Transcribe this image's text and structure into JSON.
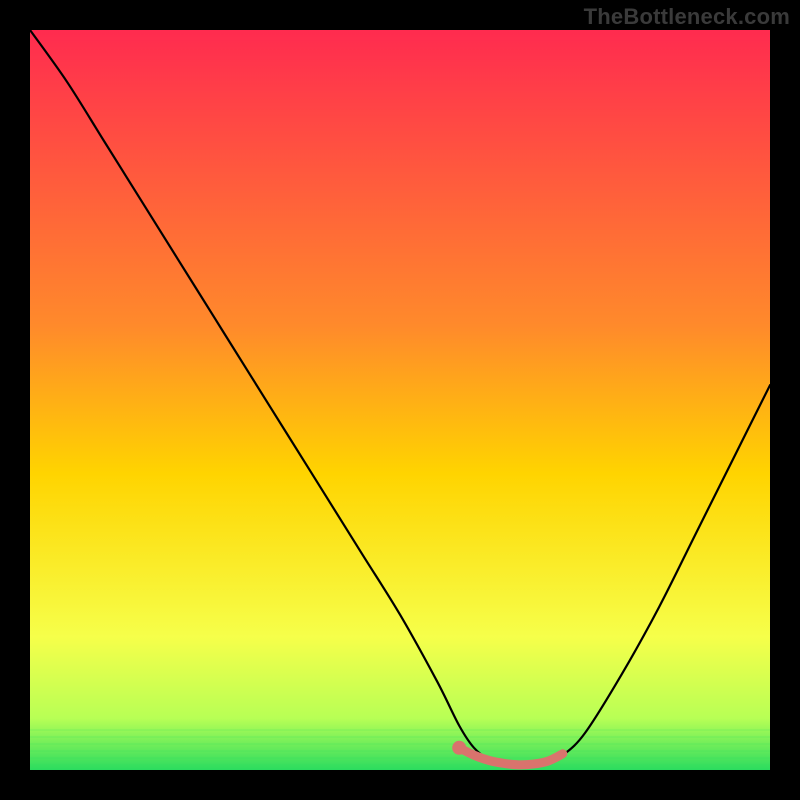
{
  "attribution": "TheBottleneck.com",
  "colors": {
    "frame": "#000000",
    "gradient_top": "#ff2b4f",
    "gradient_mid": "#ffd400",
    "gradient_green_light": "#e6ff66",
    "gradient_green": "#2bdc5f",
    "curve": "#000000",
    "highlight": "#d9736d"
  },
  "chart_data": {
    "type": "line",
    "title": "",
    "xlabel": "",
    "ylabel": "",
    "xlim": [
      0,
      100
    ],
    "ylim": [
      0,
      100
    ],
    "series": [
      {
        "name": "bottleneck-curve",
        "x": [
          0,
          5,
          10,
          15,
          20,
          25,
          30,
          35,
          40,
          45,
          50,
          55,
          58,
          60,
          62,
          65,
          68,
          70,
          72,
          75,
          80,
          85,
          90,
          95,
          100
        ],
        "y": [
          100,
          93,
          85,
          77,
          69,
          61,
          53,
          45,
          37,
          29,
          21,
          12,
          6,
          3,
          1.5,
          0.8,
          0.6,
          1.0,
          2.0,
          5,
          13,
          22,
          32,
          42,
          52
        ]
      },
      {
        "name": "optimal-band",
        "x": [
          58,
          60,
          62,
          64,
          66,
          68,
          70,
          72
        ],
        "y": [
          3.0,
          2.0,
          1.3,
          0.9,
          0.7,
          0.8,
          1.2,
          2.2
        ]
      }
    ],
    "gradient_stops": [
      {
        "pos": 0,
        "color": "#ff2b4f"
      },
      {
        "pos": 40,
        "color": "#ff8a2b"
      },
      {
        "pos": 60,
        "color": "#ffd400"
      },
      {
        "pos": 82,
        "color": "#f6ff4a"
      },
      {
        "pos": 93,
        "color": "#b8ff55"
      },
      {
        "pos": 100,
        "color": "#2bdc5f"
      }
    ]
  }
}
